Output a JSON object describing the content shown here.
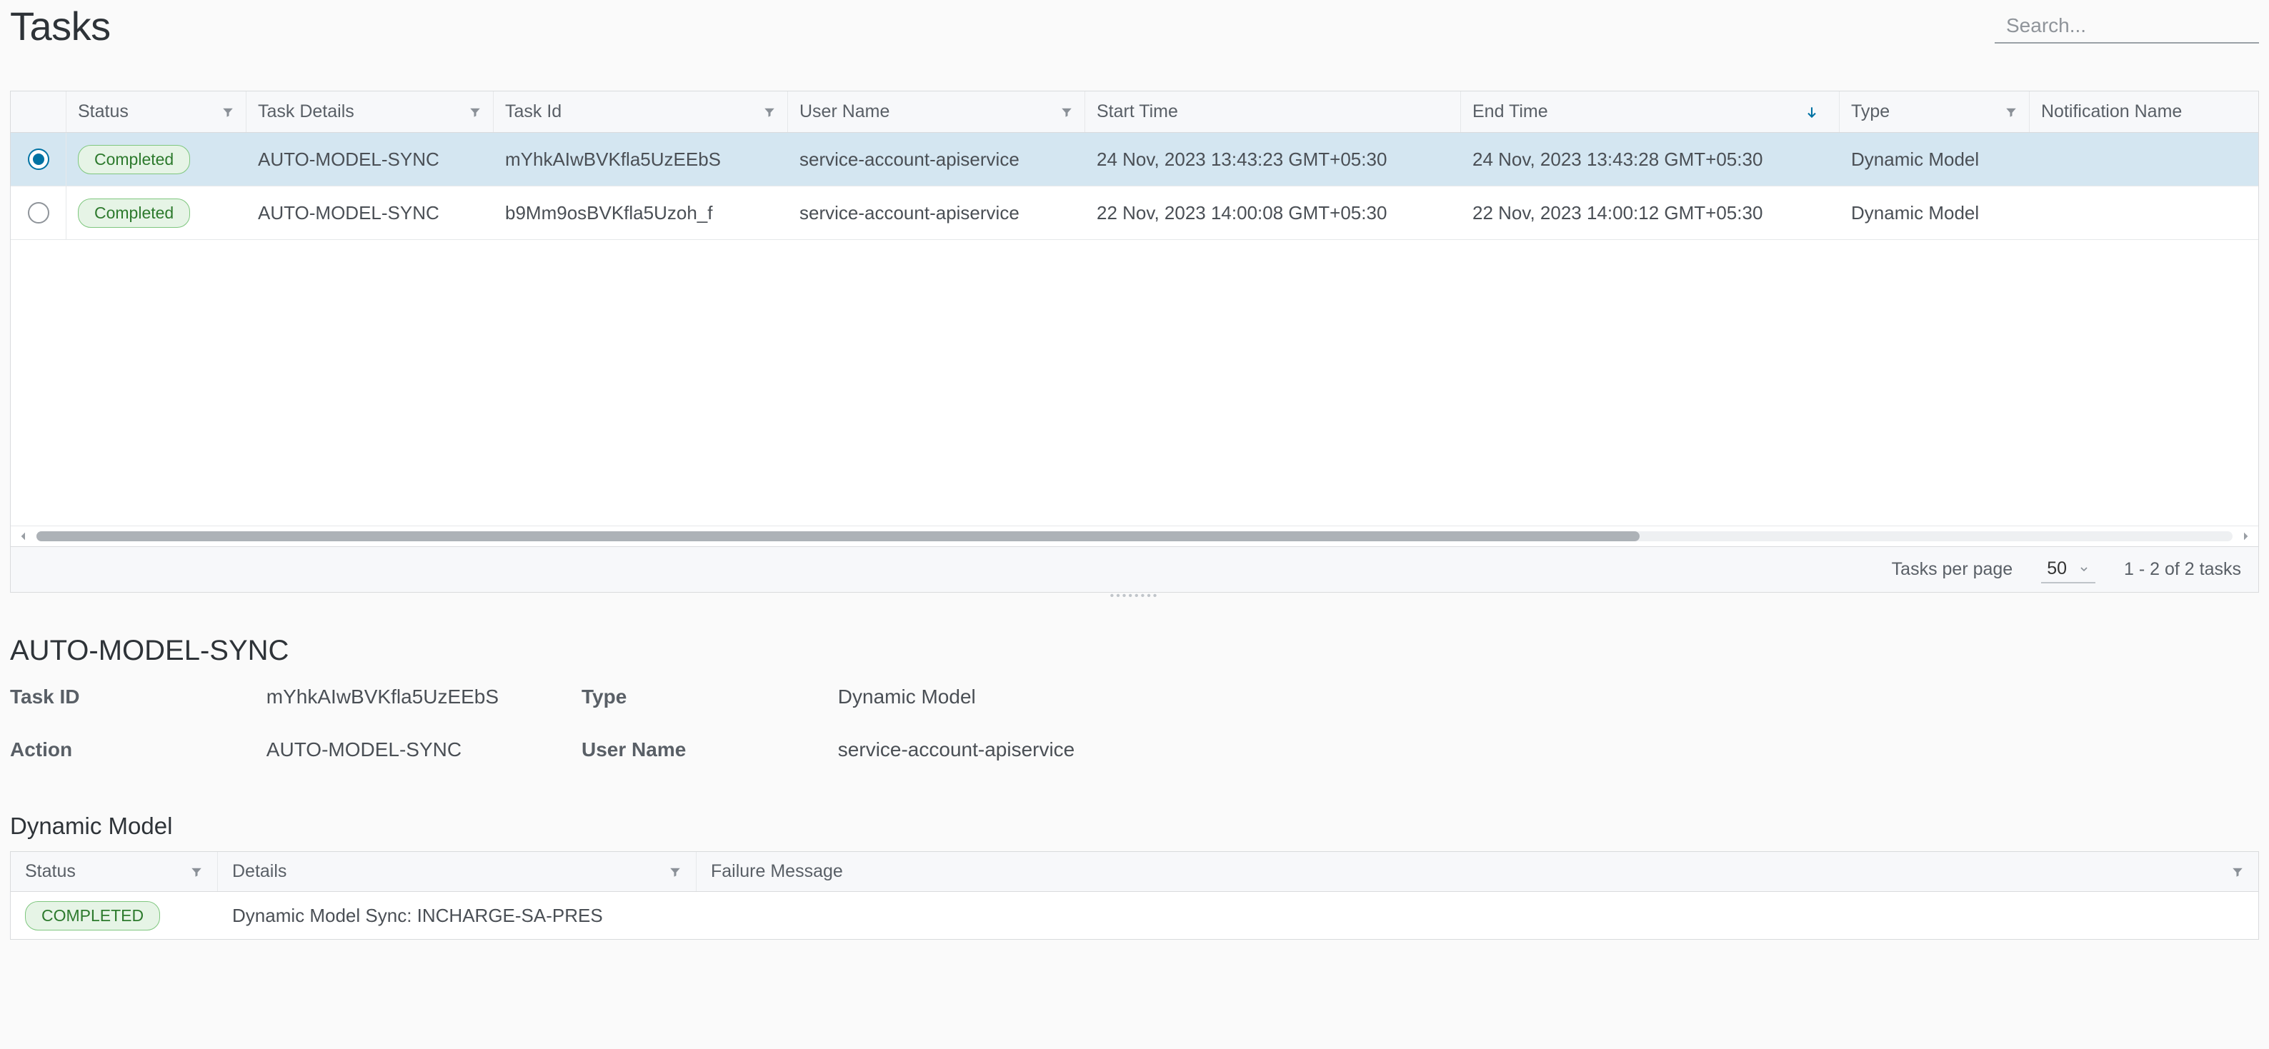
{
  "header": {
    "title": "Tasks",
    "search_placeholder": "Search..."
  },
  "columns": {
    "status": "Status",
    "task_details": "Task Details",
    "task_id": "Task Id",
    "user_name": "User Name",
    "start_time": "Start Time",
    "end_time": "End Time",
    "type": "Type",
    "notification_name": "Notification Name"
  },
  "rows": [
    {
      "selected": true,
      "status": "Completed",
      "task_details": "AUTO-MODEL-SYNC",
      "task_id": "mYhkAIwBVKfla5UzEEbS",
      "user_name": "service-account-apiservice",
      "start_time": "24 Nov, 2023 13:43:23 GMT+05:30",
      "end_time": "24 Nov, 2023 13:43:28 GMT+05:30",
      "type": "Dynamic Model"
    },
    {
      "selected": false,
      "status": "Completed",
      "task_details": "AUTO-MODEL-SYNC",
      "task_id": "b9Mm9osBVKfla5Uzoh_f",
      "user_name": "service-account-apiservice",
      "start_time": "22 Nov, 2023 14:00:08 GMT+05:30",
      "end_time": "22 Nov, 2023 14:00:12 GMT+05:30",
      "type": "Dynamic Model"
    }
  ],
  "footer": {
    "tasks_per_page_label": "Tasks per page",
    "tasks_per_page_value": "50",
    "range_text": "1 - 2 of 2 tasks"
  },
  "detail": {
    "title": "AUTO-MODEL-SYNC",
    "labels": {
      "task_id": "Task ID",
      "type": "Type",
      "action": "Action",
      "user_name": "User Name"
    },
    "values": {
      "task_id": "mYhkAIwBVKfla5UzEEbS",
      "type": "Dynamic Model",
      "action": "AUTO-MODEL-SYNC",
      "user_name": "service-account-apiservice"
    },
    "sub_title": "Dynamic Model",
    "sub_columns": {
      "status": "Status",
      "details": "Details",
      "failure": "Failure Message"
    },
    "sub_row": {
      "status": "COMPLETED",
      "details": "Dynamic Model Sync: INCHARGE-SA-PRES",
      "failure": ""
    }
  }
}
